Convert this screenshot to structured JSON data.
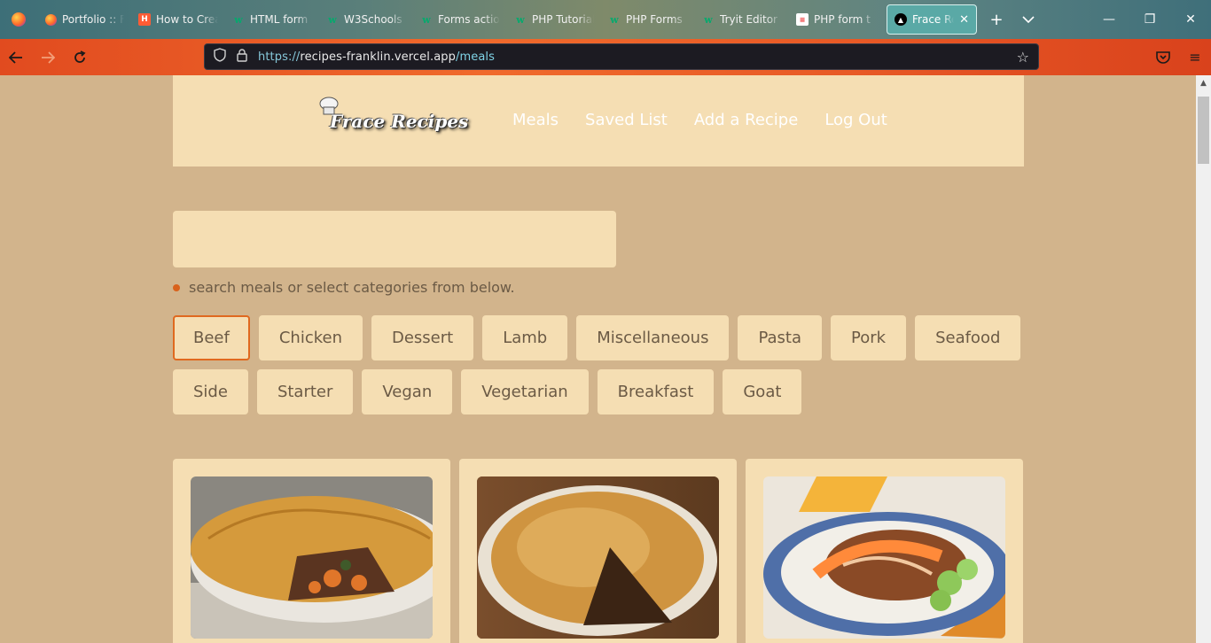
{
  "browser": {
    "tabs": [
      {
        "label": "Portfolio :: Frank",
        "icon": "firefox-icon"
      },
      {
        "label": "How to Create",
        "icon": "hubspot-icon"
      },
      {
        "label": "HTML form",
        "icon": "w3schools-icon"
      },
      {
        "label": "W3Schools",
        "icon": "w3schools-icon"
      },
      {
        "label": "Forms action",
        "icon": "w3schools-icon"
      },
      {
        "label": "PHP Tutorial",
        "icon": "w3schools-icon"
      },
      {
        "label": "PHP Forms",
        "icon": "w3schools-icon"
      },
      {
        "label": "Tryit Editor",
        "icon": "w3schools-icon"
      },
      {
        "label": "PHP form t",
        "icon": "document-icon"
      }
    ],
    "active_tab": {
      "label": "Frace Recipes",
      "icon": "vercel-icon"
    },
    "url": {
      "scheme": "https://",
      "host": "recipes-franklin.vercel.app",
      "path": "/meals"
    }
  },
  "site": {
    "logo_text": "Frace Recipes",
    "nav": [
      "Meals",
      "Saved List",
      "Add a Recipe",
      "Log Out"
    ],
    "search": {
      "value": "",
      "placeholder": ""
    },
    "hint": "search meals or select categories from below.",
    "categories_row1": [
      "Beef",
      "Chicken",
      "Dessert",
      "Lamb",
      "Miscellaneous",
      "Pasta",
      "Pork",
      "Seafood"
    ],
    "categories_row2": [
      "Side",
      "Starter",
      "Vegan",
      "Vegetarian",
      "Breakfast",
      "Goat"
    ],
    "selected_category": "Beef",
    "meal_cards": [
      {
        "image": "beef-pie-photo"
      },
      {
        "image": "pie-slice-photo"
      },
      {
        "image": "beef-salad-bowl-photo"
      }
    ]
  },
  "colors": {
    "page_bg": "#d2b48c",
    "panel_bg": "#f5deb3",
    "accent": "#e0691f",
    "text": "#6b5a45"
  }
}
